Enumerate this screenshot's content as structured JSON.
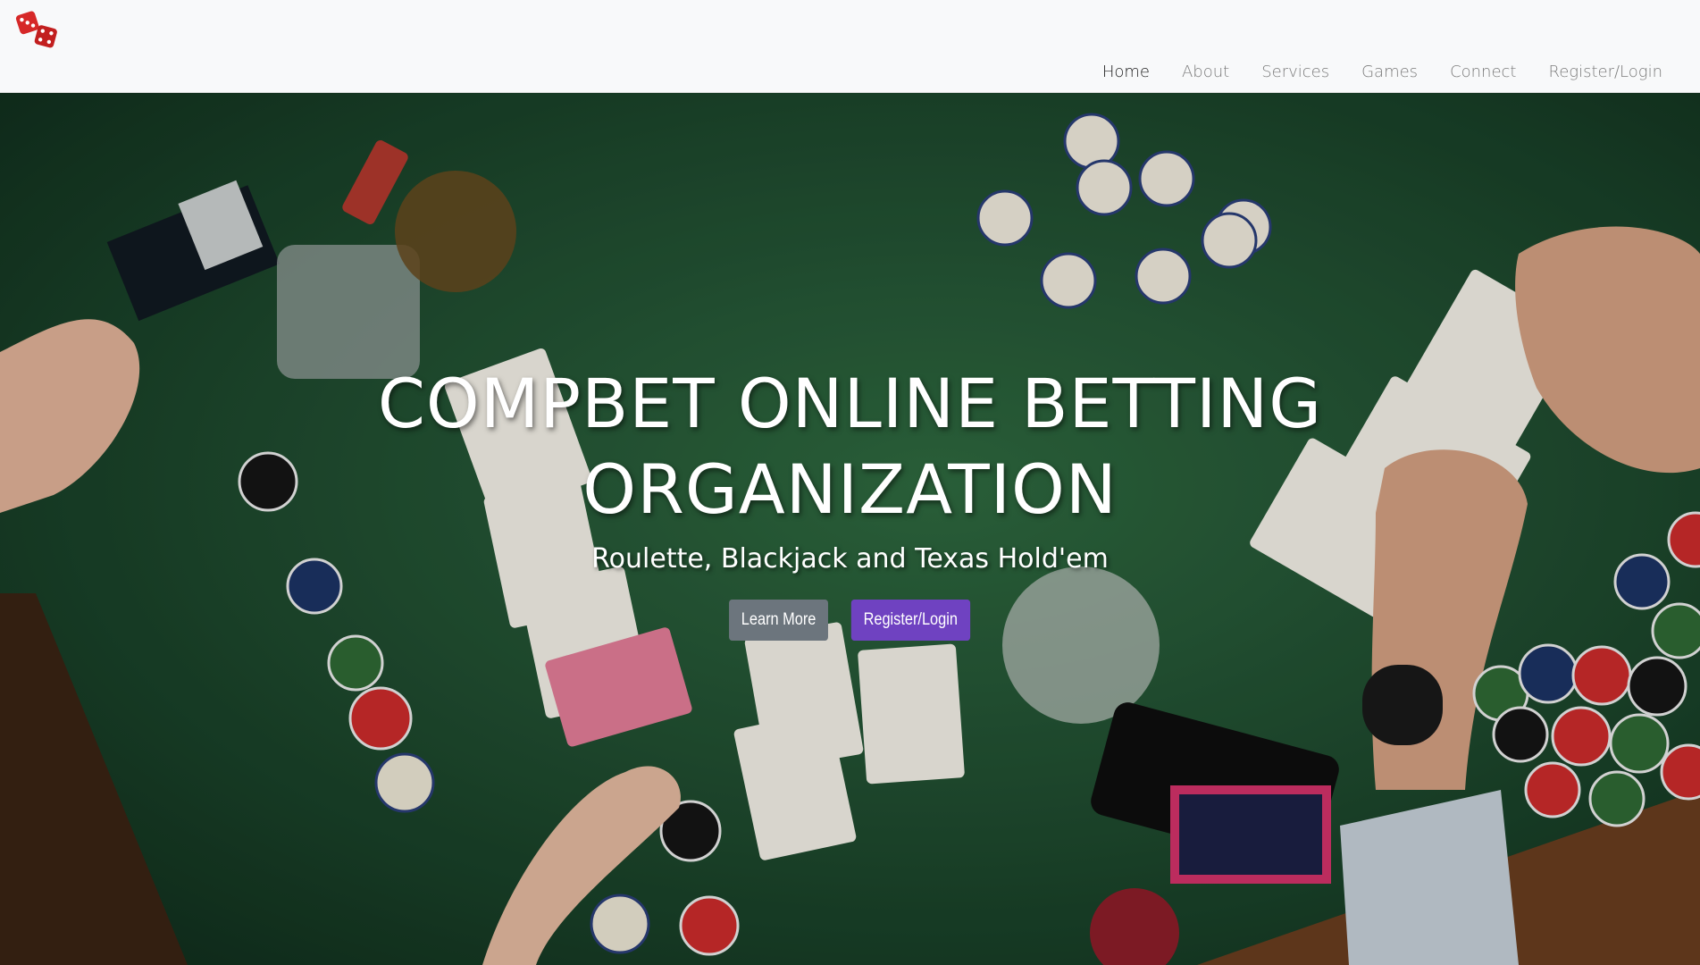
{
  "brand": {
    "logo_icon": "dice-icon",
    "colors": {
      "dice": "#d62828",
      "pips": "#ffffff"
    }
  },
  "nav": {
    "items": [
      {
        "label": "Home",
        "active": true
      },
      {
        "label": "About",
        "active": false
      },
      {
        "label": "Services",
        "active": false
      },
      {
        "label": "Games",
        "active": false
      },
      {
        "label": "Connect",
        "active": false
      },
      {
        "label": "Register/Login",
        "active": false
      }
    ]
  },
  "hero": {
    "title": "COMPBET ONLINE BETTING ORGANIZATION",
    "subtitle": "Roulette, Blackjack and Texas Hold'em",
    "buttons": {
      "learn_more": "Learn More",
      "register_login": "Register/Login"
    },
    "background_image": "poker-table-photo",
    "colors": {
      "felt": "#245535",
      "learn_more_button": "#6c757d",
      "register_button": "#6f42c1"
    }
  }
}
